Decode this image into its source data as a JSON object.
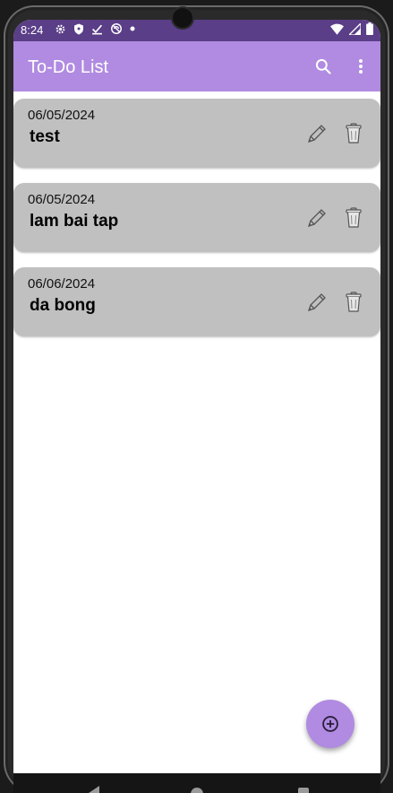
{
  "status_bar": {
    "time": "8:24",
    "left_icons": [
      "gear-icon",
      "shield-icon",
      "download-check-icon",
      "sync-icon",
      "dot-icon"
    ],
    "right_icons": [
      "wifi-icon",
      "signal-icon",
      "battery-icon"
    ]
  },
  "appbar": {
    "title": "To-Do List",
    "search_icon": "search-icon",
    "menu_icon": "more-vert-icon"
  },
  "tasks": [
    {
      "date": "06/05/2024",
      "title": "test"
    },
    {
      "date": "06/05/2024",
      "title": "lam bai tap"
    },
    {
      "date": "06/06/2024",
      "title": "da bong"
    }
  ],
  "fab": {
    "icon": "add-circle-icon"
  },
  "colors": {
    "status_bar": "#5a3e87",
    "appbar": "#b08be1",
    "card": "#c0c0c0",
    "fab": "#b08be1"
  }
}
